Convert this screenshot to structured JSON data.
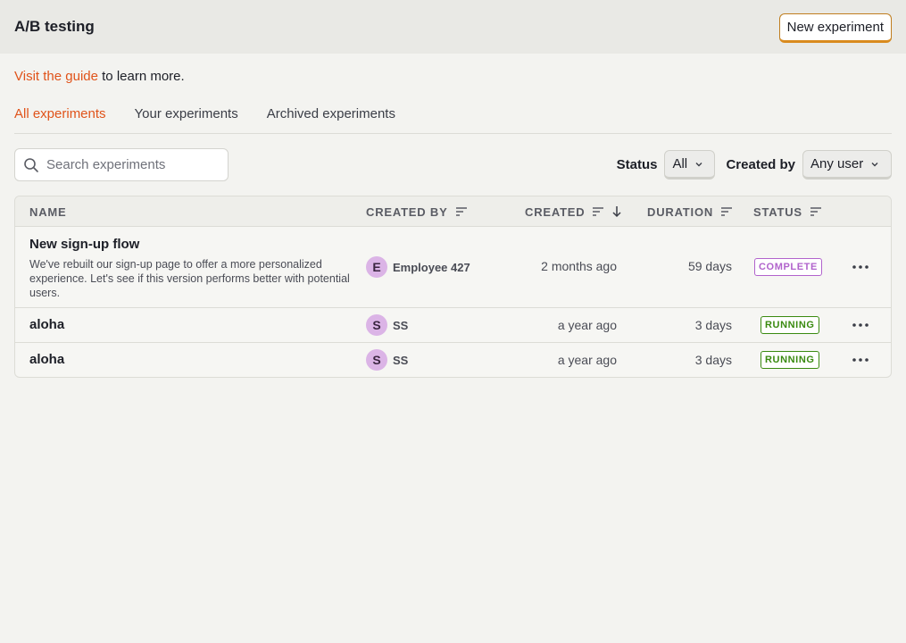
{
  "header": {
    "title": "A/B testing",
    "new_button": "New experiment"
  },
  "guide": {
    "link": "Visit the guide",
    "rest": " to learn more."
  },
  "tabs": [
    {
      "label": "All experiments",
      "active": true
    },
    {
      "label": "Your experiments",
      "active": false
    },
    {
      "label": "Archived experiments",
      "active": false
    }
  ],
  "filters": {
    "search_placeholder": "Search experiments",
    "status_label": "Status",
    "status_value": "All",
    "created_by_label": "Created by",
    "created_by_value": "Any user"
  },
  "table": {
    "columns": [
      "NAME",
      "CREATED BY",
      "CREATED",
      "DURATION",
      "STATUS"
    ],
    "rows": [
      {
        "name": "New sign-up flow",
        "description": "We've rebuilt our sign-up page to offer a more personalized experience. Let's see if this version performs better with potential users.",
        "avatar": "E",
        "created_by": "Employee 427",
        "created": "2 months ago",
        "duration": "59 days",
        "status": "COMPLETE"
      },
      {
        "name": "aloha",
        "description": "",
        "avatar": "S",
        "created_by": "SS",
        "created": "a year ago",
        "duration": "3 days",
        "status": "RUNNING"
      },
      {
        "name": "aloha",
        "description": "",
        "avatar": "S",
        "created_by": "SS",
        "created": "a year ago",
        "duration": "3 days",
        "status": "RUNNING"
      }
    ]
  },
  "colors": {
    "accent": "#e0531a",
    "complete": "#b163cc",
    "running": "#3a8a10",
    "avatar": "#dbb4e6"
  },
  "icons": {
    "search": "search-icon",
    "chevron": "chevron-down-icon",
    "sort": "sort-icon",
    "sort_desc": "arrow-down-icon",
    "more": "more-horizontal-icon"
  }
}
